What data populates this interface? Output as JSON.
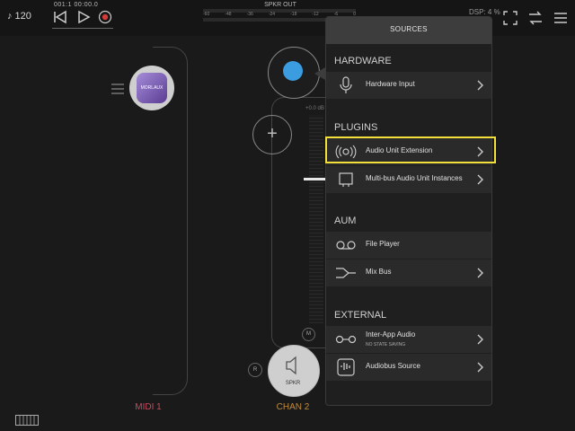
{
  "topbar": {
    "tempo": "♪ 120",
    "counter": "001:1  00:00.0",
    "meter_title": "SPKR OUT",
    "meter_scale": [
      "-60",
      "-48",
      "-36",
      "-24",
      "-18",
      "-12",
      "-6",
      "0"
    ],
    "dsp": "DSP: 4 %"
  },
  "left": {
    "plugin_name": "MORLAUX",
    "midi_label": "MIDI 1"
  },
  "channel": {
    "db_label": "+0.0 dB",
    "mute_label": "M",
    "r_label": "R",
    "output_label": "SPKR",
    "chan_label": "CHAN 2"
  },
  "popover": {
    "title": "SOURCES",
    "sections": {
      "hardware": "HARDWARE",
      "plugins": "PLUGINS",
      "aum": "AUM",
      "external": "EXTERNAL"
    },
    "items": {
      "hardware_input": "Hardware Input",
      "audio_unit_extension": "Audio Unit Extension",
      "multibus": "Multi-bus Audio Unit Instances",
      "file_player": "File Player",
      "mix_bus": "Mix Bus",
      "inter_app": "Inter-App Audio",
      "inter_app_sub": "NO STATE SAVING",
      "audiobus": "Audiobus Source"
    }
  },
  "colors": {
    "accent_blue": "#3b9de0",
    "highlight": "#f2df3a",
    "midi_red": "#c84b5e",
    "chan_orange": "#c28a3c"
  }
}
